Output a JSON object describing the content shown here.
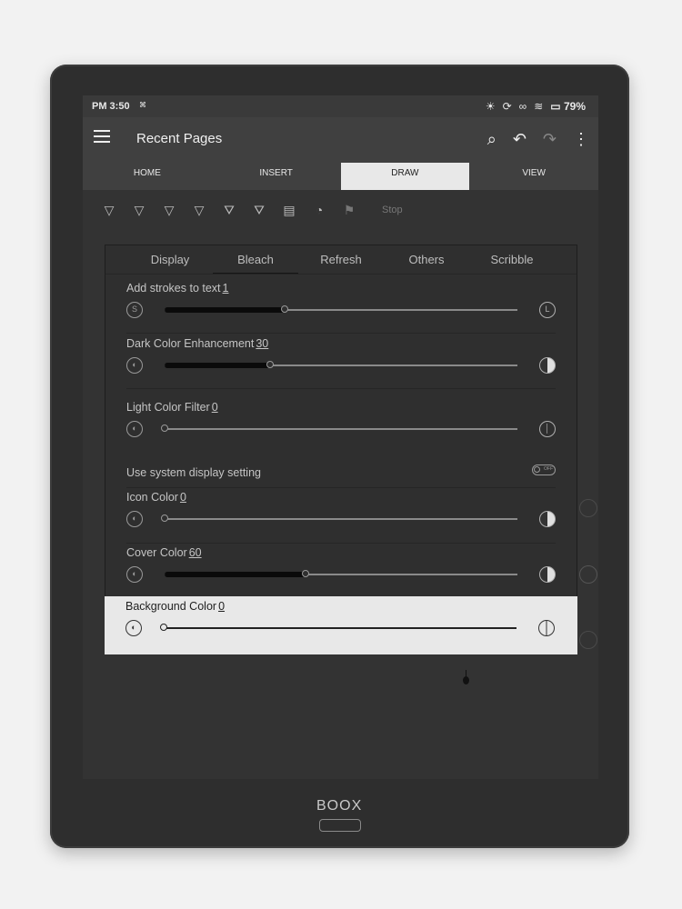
{
  "status": {
    "time": "PM 3:50",
    "battery": "79%"
  },
  "app": {
    "title": "Recent Pages"
  },
  "main_tabs": [
    "HOME",
    "INSERT",
    "DRAW",
    "VIEW"
  ],
  "main_tabs_active": "DRAW",
  "toolbar": {
    "stop_label": "Stop"
  },
  "panel": {
    "tabs": [
      "Display",
      "Bleach",
      "Refresh",
      "Others",
      "Scribble"
    ],
    "active_tab": "Bleach",
    "settings": [
      {
        "label": "Add strokes to text",
        "value": "1",
        "fraction": 0.34
      },
      {
        "label": "Dark Color Enhancement",
        "value": "30",
        "fraction": 0.3
      },
      {
        "label": "Light Color Filter",
        "value": "0",
        "fraction": 0.0
      },
      {
        "label": "Icon Color",
        "value": "0",
        "fraction": 0.0
      },
      {
        "label": "Cover Color",
        "value": "60",
        "fraction": 0.4
      },
      {
        "label": "Background Color",
        "value": "0",
        "fraction": 0.0
      }
    ],
    "toggle": {
      "label": "Use system display setting",
      "state": "OFF"
    },
    "icon_labels": {
      "small": "S",
      "large": "L"
    }
  },
  "device": {
    "brand": "BOOX"
  }
}
